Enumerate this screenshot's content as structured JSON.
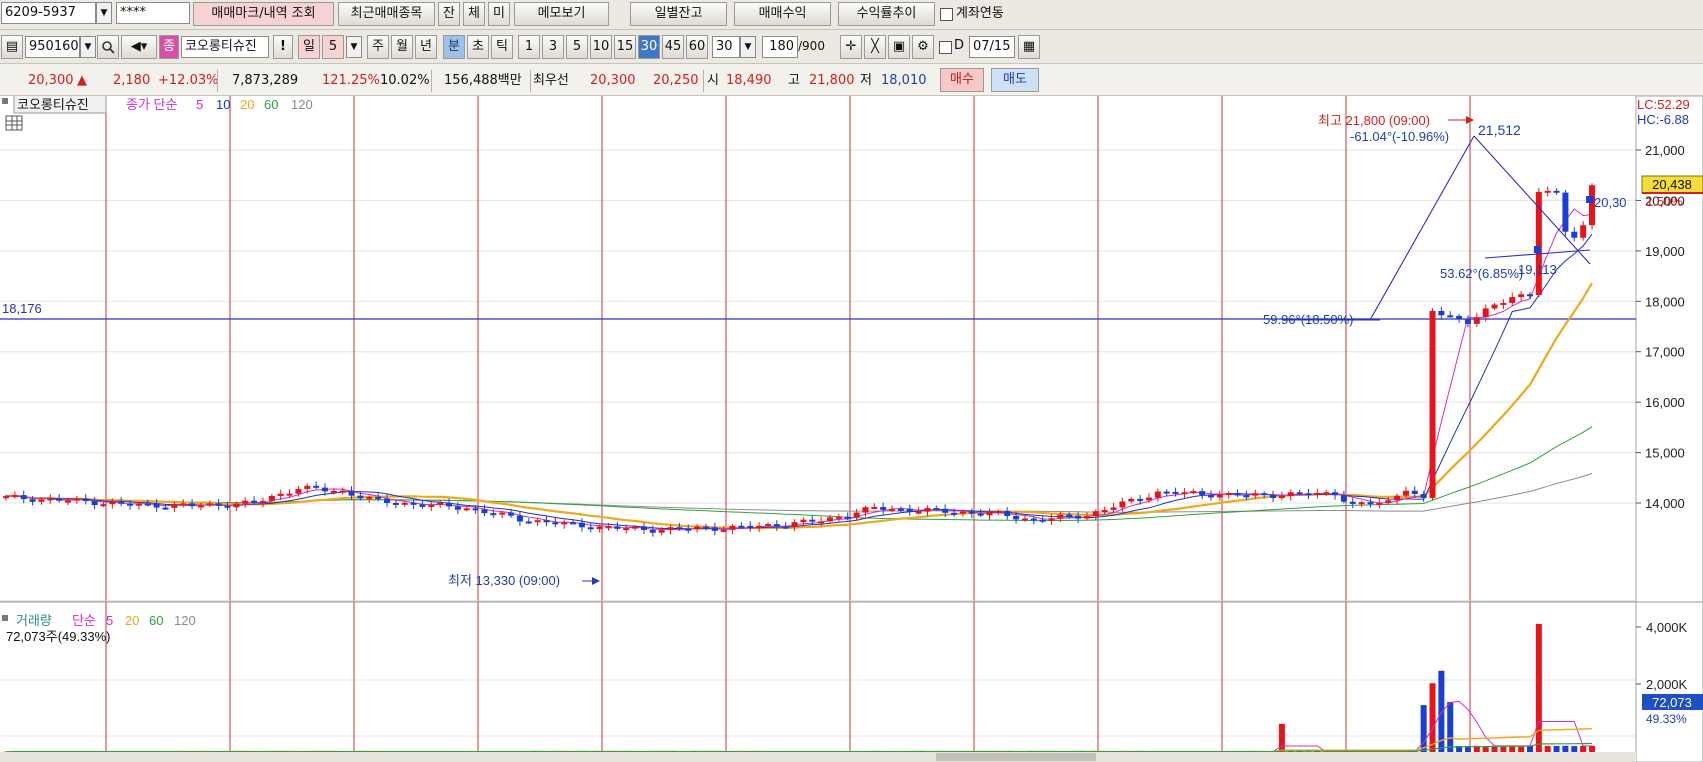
{
  "toolbar1": {
    "account": "6209-5937",
    "password": "****",
    "btn_trade_mark": "매매마크/내역 조회",
    "btn_recent": "최근매매종목",
    "btn_jan": "잔",
    "btn_che": "체",
    "btn_mi": "미",
    "btn_memo": "메모보기",
    "btn_daily": "일별잔고",
    "btn_profit": "매매수익",
    "btn_rate": "수익률추이",
    "link_label": "계좌연동"
  },
  "toolbar2": {
    "code": "950160",
    "badge": "종",
    "stock_name": "코오롱티슈진",
    "excl": "!",
    "period_day": "일",
    "period_day_n": "5",
    "period_week": "주",
    "period_month": "월",
    "period_year": "년",
    "period_min": "분",
    "period_sec": "초",
    "period_tick": "틱",
    "minutes": [
      "1",
      "3",
      "5",
      "10",
      "15",
      "30",
      "45",
      "60"
    ],
    "selected_minute": "30",
    "minute_select": "30",
    "count": "180",
    "count_total": "/900",
    "d_label": "D",
    "date": "07/15"
  },
  "quote": {
    "price": "20,300",
    "arrow": "▲",
    "change": "2,180",
    "change_pct": "+12.03%",
    "volume": "7,873,289",
    "volume_ratio": "121.25%",
    "turnover": "10.02%",
    "amount": "156,488백만",
    "best_label": "최우선",
    "best_ask": "20,300",
    "best_bid": "20,250",
    "open_label": "시",
    "open": "18,490",
    "high_label": "고",
    "high": "21,800",
    "low_label": "저",
    "low": "18,010",
    "buy_btn": "매수",
    "sell_btn": "매도"
  },
  "price_panel": {
    "stock_label": "코오롱티슈진",
    "legend_title": "종가 단순",
    "ma": [
      "5",
      "10",
      "20",
      "60",
      "120"
    ],
    "hline_label": "18,176",
    "high_annot": "최고 21,800 (09:00)",
    "low_annot": "최저 13,330 (09:00)",
    "trend1_angle": "-61.04°(-10.96%)",
    "trend1_end": "21,512",
    "trend2_angle": "59.96°(18.50%)",
    "trend3_angle": "53.62°(6.85%)",
    "trend3_end": "19,113",
    "last_label": "20,30",
    "lc": "LC:52.29",
    "hc": "HC:-6.88",
    "axis_ticks": [
      "21,000",
      "20,000",
      "19,000",
      "18,000",
      "17,000",
      "16,000",
      "15,000",
      "14,000"
    ],
    "cur_price_box": "20,438",
    "cur_pct": "1.50%"
  },
  "volume_panel": {
    "title": "거래량",
    "legend_title": "단순",
    "ma": [
      "5",
      "20",
      "60",
      "120"
    ],
    "current": "72,073주(49.33%)",
    "axis_ticks": [
      "4,000K",
      "2,000K"
    ],
    "cur_box": "72,073",
    "cur_pct": "49.33%"
  },
  "colors": {
    "up": "#e8141b",
    "down": "#1a3fd6",
    "ma5": "#d42ec3",
    "ma10": "#1f33b8",
    "ma20": "#efa81c",
    "ma60": "#2fa13f",
    "ma120": "#8c8c8c",
    "grid_v": "#c8343b"
  }
}
